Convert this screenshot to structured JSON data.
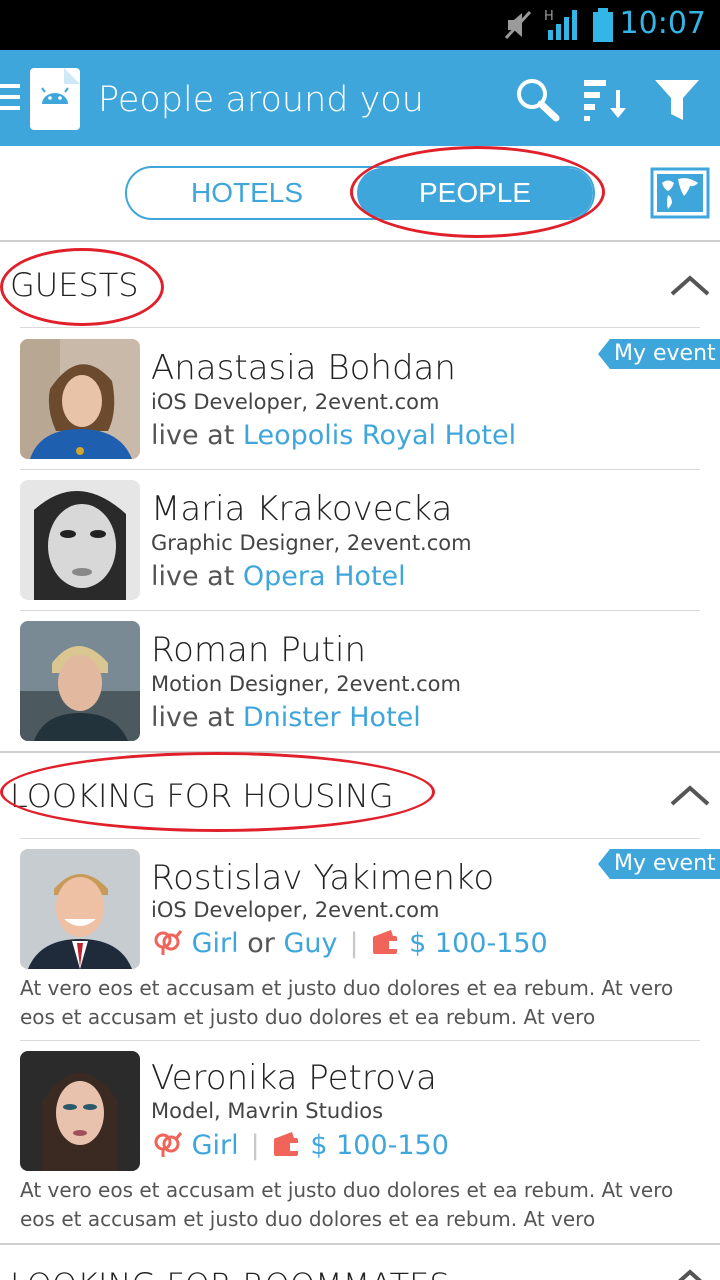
{
  "status_bar": {
    "time": "10:07",
    "signal_label": "H"
  },
  "app_bar": {
    "title": "People around you",
    "actions": [
      "search-icon",
      "sort-icon",
      "filter-icon"
    ]
  },
  "tabs": {
    "hotels": "HOTELS",
    "people": "PEOPLE",
    "selected": "PEOPLE"
  },
  "sections": {
    "guests": {
      "title": "GUESTS",
      "people": [
        {
          "name": "Anastasia Bohdan",
          "role": "iOS Developer, 2event.com",
          "live_prefix": "live at ",
          "hotel": "Leopolis Royal Hotel",
          "badge": "My event"
        },
        {
          "name": "Maria Krakovecka",
          "role": "Graphic Designer, 2event.com",
          "live_prefix": "live at ",
          "hotel": "Opera Hotel"
        },
        {
          "name": "Roman Putin",
          "role": "Motion Designer, 2event.com",
          "live_prefix": "live at ",
          "hotel": "Dnister Hotel"
        }
      ]
    },
    "housing": {
      "title": "LOOKING FOR HOUSING",
      "people": [
        {
          "name": "Rostislav Yakimenko",
          "role": "iOS Developer, 2event.com",
          "badge": "My event",
          "gender1": "Girl",
          "or": "or",
          "gender2": "Guy",
          "price": "$ 100-150",
          "description": "At vero eos et accusam et justo duo dolores et ea rebum. At vero eos et accusam et justo duo dolores et ea rebum. At vero"
        },
        {
          "name": "Veronika Petrova",
          "role": "Model, Mavrin Studios",
          "gender1": "Girl",
          "price": "$ 100-150",
          "description": "At vero eos et accusam et justo duo dolores et ea rebum. At vero eos et accusam et justo duo dolores et ea rebum. At vero"
        }
      ]
    },
    "roommates": {
      "title": "LOOKING FOR ROOMMATES"
    }
  },
  "colors": {
    "accent": "#3fa6dc",
    "annotation": "#e0202a",
    "price_icon": "#f0645a"
  }
}
